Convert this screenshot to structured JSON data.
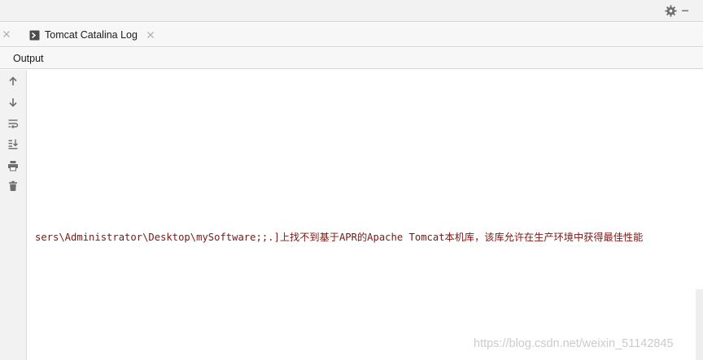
{
  "tool_window": {
    "tab": {
      "label": "Tomcat Catalina Log",
      "icon": "console-run-icon"
    },
    "sub_tab": {
      "label": "Output"
    },
    "settings_icon": "gear-icon"
  },
  "toolbar": [
    {
      "name": "scroll-up-icon"
    },
    {
      "name": "scroll-down-icon"
    },
    {
      "name": "soft-wrap-icon"
    },
    {
      "name": "scroll-to-end-icon"
    },
    {
      "name": "print-icon"
    },
    {
      "name": "clear-all-icon"
    }
  ],
  "console": {
    "line": "sers\\Administrator\\Desktop\\mySoftware;;.]上找不到基于APR的Apache Tomcat本机库，该库允许在生产环境中获得最佳性能",
    "text_color": "#7a1714"
  },
  "watermark": "https://blog.csdn.net/weixin_51142845",
  "colors": {
    "panel_bg": "#f2f2f2",
    "border": "#d4d4d4",
    "icon": "#6e6e6e"
  }
}
